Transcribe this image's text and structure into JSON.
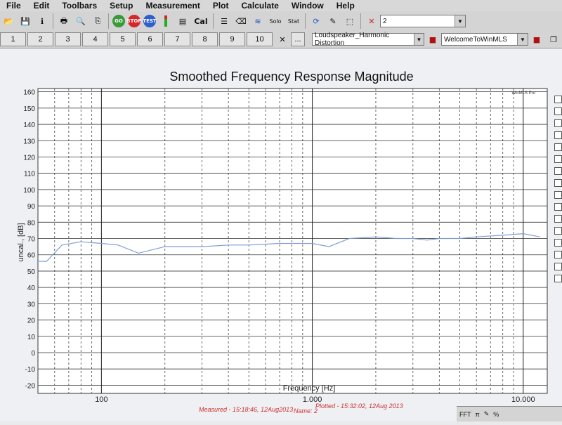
{
  "menu": [
    "File",
    "Edit",
    "Toolbars",
    "Setup",
    "Measurement",
    "Plot",
    "Calculate",
    "Window",
    "Help"
  ],
  "toolbar": {
    "go_label": "GO",
    "stop_label": "STOP",
    "test_label": "TEST",
    "cal_label": "Cal",
    "solo_label": "Solo",
    "stat_label": "Stat",
    "trace_value": "2"
  },
  "toolbar2": {
    "numbers": [
      "1",
      "2",
      "3",
      "4",
      "5",
      "6",
      "7",
      "8",
      "9",
      "10"
    ],
    "more_label": "...",
    "macro_value": "Loudspeaker_Harmonic Distortion",
    "welcome_value": "WelcomeToWinMLS"
  },
  "status_bar": {
    "fft_label": "FFT"
  },
  "chart_data": {
    "type": "line",
    "title": "Smoothed Frequency Response Magnitude",
    "xlabel": "Frequency [Hz]",
    "ylabel": "uncal., [dB]",
    "x_scale": "log",
    "xlim": [
      50,
      13000
    ],
    "ylim": [
      -25,
      162
    ],
    "y_ticks": [
      160,
      150,
      140,
      130,
      120,
      110,
      100,
      90,
      80,
      70,
      60,
      50,
      40,
      30,
      20,
      10,
      0,
      -10,
      -20
    ],
    "x_tick_labels": [
      {
        "value": 100,
        "label": "100"
      },
      {
        "value": 1000,
        "label": "1.000"
      },
      {
        "value": 10000,
        "label": "10.000"
      }
    ],
    "grid": true,
    "corner_label": "WinMLS Pro",
    "annotations": {
      "measured": "Measured - 15:18:46, 12Aug2013",
      "plotted": "Plotted - 15:32:02, 12Aug 2013",
      "name": "Name: 2"
    },
    "series_color": "#7f9ed6",
    "series": [
      {
        "x": [
          50,
          55,
          65,
          80,
          100,
          120,
          150,
          200,
          300,
          400,
          500,
          700,
          1000,
          1200,
          1500,
          2000,
          2500,
          3000,
          3500,
          4000,
          5000,
          6000,
          8000,
          10000,
          12000
        ],
        "y": [
          56,
          56,
          66,
          68,
          67,
          66,
          61,
          65,
          65,
          66,
          66,
          67,
          67,
          65,
          70,
          71,
          70,
          70,
          69,
          70,
          70,
          71,
          72,
          73,
          71
        ]
      }
    ]
  }
}
